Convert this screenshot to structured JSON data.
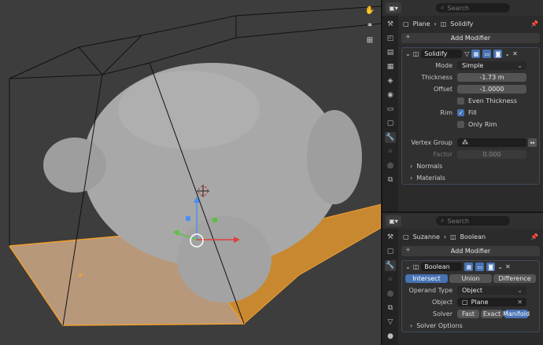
{
  "viewport": {
    "tools": [
      "hand-icon",
      "camera-icon",
      "grid-icon"
    ]
  },
  "top_panel": {
    "search_placeholder": "Search",
    "breadcrumb": {
      "object": "Plane",
      "modifier": "Solidify"
    },
    "add_modifier": "Add Modifier",
    "modifier": {
      "name": "Solidify",
      "mode_label": "Mode",
      "mode_value": "Simple",
      "thickness_label": "Thickness",
      "thickness_value": "-1.73 m",
      "offset_label": "Offset",
      "offset_value": "-1.0000",
      "even_thickness": "Even Thickness",
      "rim_label": "Rim",
      "fill": "Fill",
      "only_rim": "Only Rim",
      "vertex_group_label": "Vertex Group",
      "factor_label": "Factor",
      "factor_value": "0.000",
      "normals": "Normals",
      "materials": "Materials"
    }
  },
  "bottom_panel": {
    "search_placeholder": "Search",
    "breadcrumb": {
      "object": "Suzanne",
      "modifier": "Boolean"
    },
    "add_modifier": "Add Modifier",
    "modifier": {
      "name": "Boolean",
      "ops": [
        "Intersect",
        "Union",
        "Difference"
      ],
      "operand_type_label": "Operand Type",
      "operand_type_value": "Object",
      "object_label": "Object",
      "object_value": "Plane",
      "solver_label": "Solver",
      "solvers": [
        "Fast",
        "Exact",
        "Manifold"
      ],
      "solver_options": "Solver Options"
    }
  },
  "colors": {
    "accent": "#4772b3",
    "selection_orange": "#f5a623",
    "viewport_bg": "#3d3d3d"
  }
}
